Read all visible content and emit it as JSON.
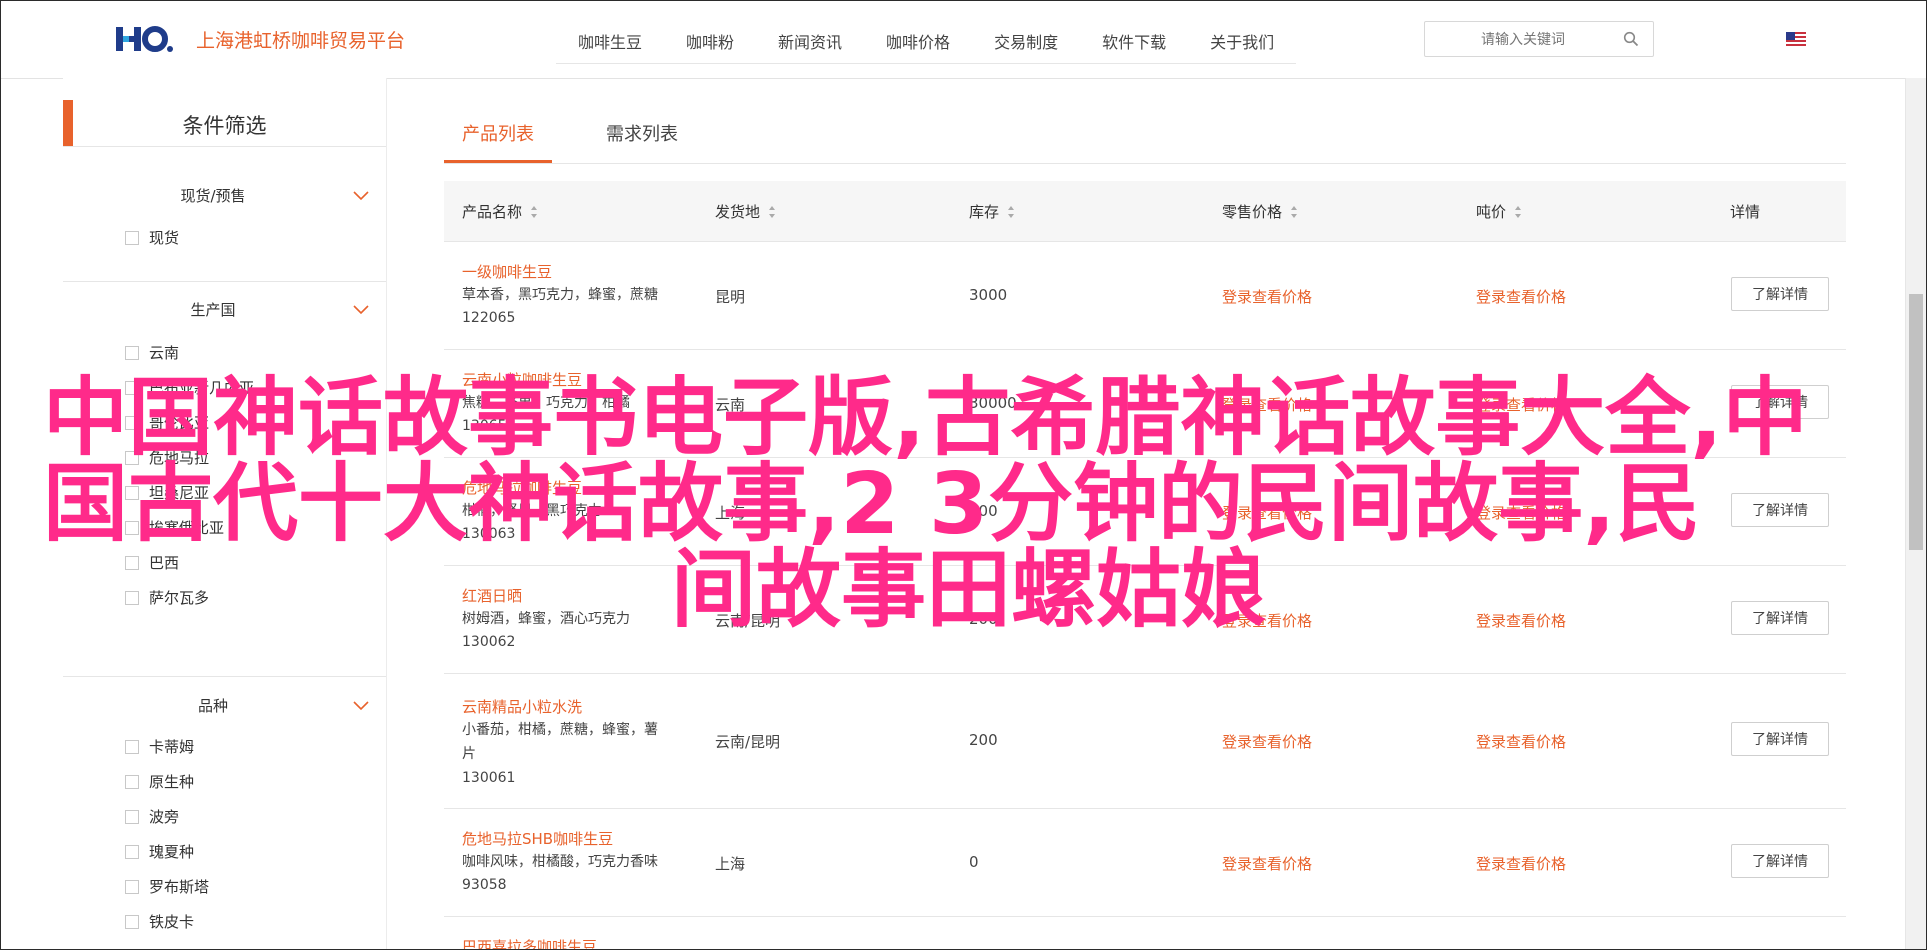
{
  "header": {
    "logo_mark": "HO.",
    "logo_text": "上海港虹桥咖啡贸易平台",
    "nav": [
      "咖啡生豆",
      "咖啡粉",
      "新闻资讯",
      "咖啡价格",
      "交易制度",
      "软件下载",
      "关于我们"
    ],
    "search_placeholder": "请输入关键词"
  },
  "sidebar": {
    "title": "条件筛选",
    "groups": [
      {
        "title": "现货/预售",
        "options": [
          "现货"
        ]
      },
      {
        "title": "生产国",
        "options": [
          "云南",
          "巴布亚新几内亚",
          "哥伦比亚",
          "危地马拉",
          "坦桑尼亚",
          "埃塞俄比亚",
          "巴西",
          "萨尔瓦多"
        ]
      },
      {
        "title": "品种",
        "options": [
          "卡蒂姆",
          "原生种",
          "波旁",
          "瑰夏种",
          "罗布斯塔",
          "铁皮卡"
        ]
      }
    ]
  },
  "tabs": [
    {
      "label": "产品列表",
      "active": true
    },
    {
      "label": "需求列表",
      "active": false
    }
  ],
  "table": {
    "headers": [
      "产品名称",
      "发货地",
      "库存",
      "零售价格",
      "吨价",
      "详情"
    ],
    "rows": [
      {
        "name": "一级咖啡生豆",
        "desc": [
          "草本香，黑巧克力，蜂蜜，蔗糖"
        ],
        "code": "122065",
        "origin": "昆明",
        "stock": "3000",
        "retail": "登录查看价格",
        "ton": "登录查看价格",
        "detail": "了解详情"
      },
      {
        "name": "云南小粒咖啡生豆",
        "desc": [
          "焦糖，坚果，巧克力，柑橘"
        ],
        "code": "13065",
        "origin": "云南",
        "stock": "30000",
        "retail": "登录查看价格",
        "ton": "登录查看价格",
        "detail": "了解详情"
      },
      {
        "name": "危地马拉咖啡生豆",
        "desc": [
          "柑橘，坚果，黑巧克力"
        ],
        "code": "130063",
        "origin": "上海",
        "stock": "100",
        "retail": "登录查看价格",
        "ton": "登录查看价格",
        "detail": "了解详情"
      },
      {
        "name": "红酒日晒",
        "desc": [
          "树姆酒，蜂蜜，酒心巧克力"
        ],
        "code": "130062",
        "origin": "云南/昆明",
        "stock": "200",
        "retail": "登录查看价格",
        "ton": "登录查看价格",
        "detail": "了解详情"
      },
      {
        "name": "云南精品小粒水洗",
        "desc": [
          "小番茄，柑橘，蔗糖，蜂蜜，薯",
          "片"
        ],
        "code": "130061",
        "origin": "云南/昆明",
        "stock": "200",
        "retail": "登录查看价格",
        "ton": "登录查看价格",
        "detail": "了解详情"
      },
      {
        "name": "危地马拉SHB咖啡生豆",
        "desc": [
          "咖啡风味，柑橘酸，巧克力香味"
        ],
        "code": "93058",
        "origin": "上海",
        "stock": "0",
        "retail": "登录查看价格",
        "ton": "登录查看价格",
        "detail": "了解详情"
      },
      {
        "name": "巴西喜拉多咖啡生豆",
        "desc": [],
        "code": "",
        "origin": "",
        "stock": "",
        "retail": "",
        "ton": "",
        "detail": ""
      }
    ]
  },
  "overlay": {
    "lines": [
      "中国神话故事书电子版,古希腊神话故事大全,中",
      "国古代十大神话故事,2 3分钟的民间故事,民",
      "间故事田螺姑娘"
    ]
  },
  "colors": {
    "accent": "#e8622c",
    "overlay": "#ff2a8a"
  }
}
